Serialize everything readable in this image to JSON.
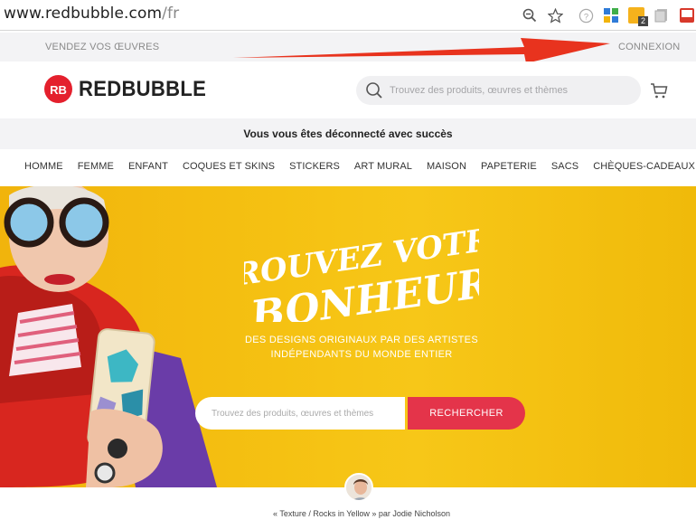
{
  "browser": {
    "url_host": "www.redbubble.com",
    "url_path": "/fr",
    "extension_badge": "2",
    "icons": [
      "zoom-icon",
      "star-icon",
      "help-icon",
      "extension-icon",
      "extension-icon",
      "extension-icon",
      "extension-icon"
    ]
  },
  "top_strip": {
    "sell_label": "VENDEZ VOS ŒUVRES",
    "login_label": "CONNEXION"
  },
  "header": {
    "logo_text": "REDBUBBLE",
    "search_placeholder": "Trouvez des produits, œuvres et thèmes"
  },
  "notice": {
    "text": "Vous vous êtes déconnecté avec succès"
  },
  "nav": {
    "items": [
      "HOMME",
      "FEMME",
      "ENFANT",
      "COQUES ET SKINS",
      "STICKERS",
      "ART MURAL",
      "MAISON",
      "PAPETERIE",
      "SACS",
      "CHÈQUES-CADEAUX"
    ]
  },
  "hero": {
    "title_line1": "TROUVEZ VOTRE",
    "title_line2": "BONHEUR",
    "subtitle": "DES DESIGNS ORIGINAUX PAR DES ARTISTES INDÉPENDANTS DU MONDE ENTIER",
    "search_placeholder": "Trouvez des produits, œuvres et thèmes",
    "search_button": "RECHERCHER",
    "credit": "« Texture / Rocks in Yellow » par Jodie Nicholson"
  },
  "colors": {
    "brand_red": "#e4202d",
    "hero_yellow": "#f5c112",
    "button_red": "#e4344a",
    "annotation_arrow": "#e8331e"
  }
}
